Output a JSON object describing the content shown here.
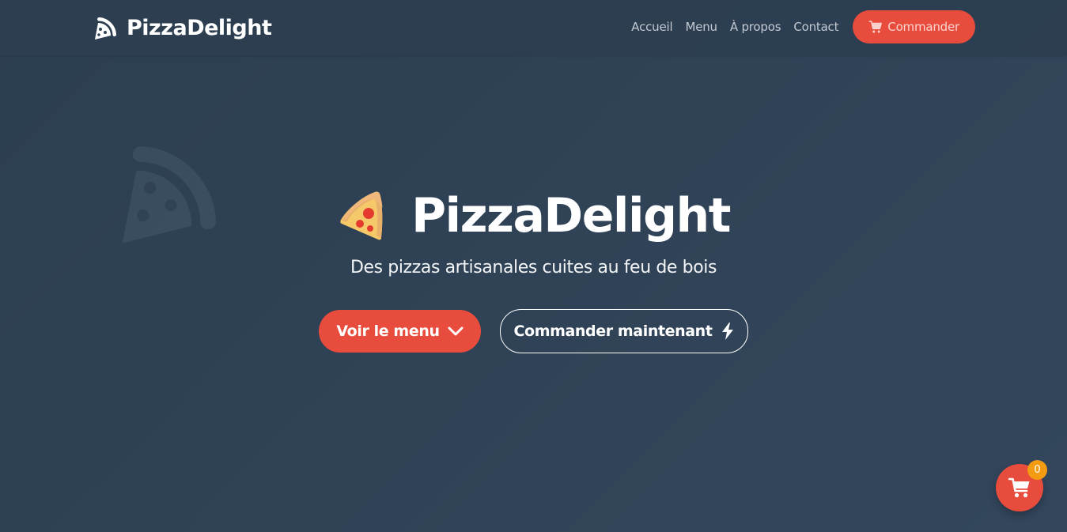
{
  "brand": {
    "name": "PizzaDelight",
    "icon": "pizza-slice-icon"
  },
  "nav": {
    "links": [
      {
        "label": "Accueil"
      },
      {
        "label": "Menu"
      },
      {
        "label": "À propos"
      },
      {
        "label": "Contact"
      }
    ],
    "cta": {
      "label": "Commander",
      "icon": "cart-icon"
    }
  },
  "hero": {
    "emoji": "pizza-emoji",
    "title": "PizzaDelight",
    "subtitle": "Des pizzas artisanales cuites au feu de bois",
    "primary_button": {
      "label": "Voir le menu",
      "icon": "chevron-down-icon"
    },
    "secondary_button": {
      "label": "Commander maintenant",
      "icon": "bolt-icon"
    }
  },
  "cart": {
    "icon": "shopping-cart-icon",
    "count": "0"
  },
  "colors": {
    "background": "#2c3e50",
    "accent": "#e74c3c",
    "badge": "#f39c12",
    "text": "#ffffff",
    "nav_link": "#c3cad3"
  }
}
